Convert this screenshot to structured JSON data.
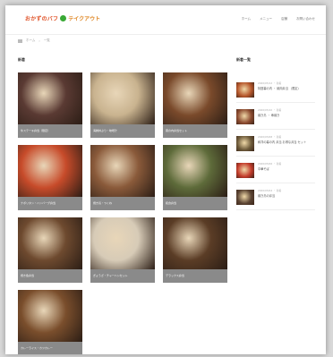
{
  "header": {
    "logo_text": "おかずのバフ",
    "logo_text2": "テイクアウト",
    "nav": [
      "ホーム",
      "メニュー",
      "店舗",
      "お問い合わせ"
    ]
  },
  "breadcrumb": {
    "items": [
      "ホーム",
      "一覧"
    ]
  },
  "main": {
    "section_title": "新着",
    "cards": [
      {
        "caption": "牛ステーキ弁当（限定）",
        "color": "#5a3a33"
      },
      {
        "caption": "海鮮丼ぶり・味噌汁",
        "color": "#c9b38f"
      },
      {
        "caption": "幕の内弁当セット",
        "color": "#7a4a2b"
      },
      {
        "caption": "ナポリタン・ハンバーグ弁当",
        "color": "#c74b2a"
      },
      {
        "caption": "焼き鳥・つくね",
        "color": "#8a5a3a"
      },
      {
        "caption": "和食弁当",
        "color": "#5e6b3a"
      },
      {
        "caption": "焼き魚弁当",
        "color": "#6e4a2f"
      },
      {
        "caption": "ぎょうざ・チャーハンセット",
        "color": "#d7cbb7"
      },
      {
        "caption": "デラックス弁当",
        "color": "#5b3d26"
      },
      {
        "caption": "カレーライス・カツカレー",
        "color": "#7a4e2c"
      }
    ]
  },
  "sidebar": {
    "title": "新着一覧",
    "items": [
      {
        "meta": "2020/05/12 ・ 新着",
        "title": "特選幕の内 ・ 焼肉弁当 （限定）",
        "color": "#b5562b"
      },
      {
        "meta": "2020/05/10 ・ 新着",
        "title": "焼き鳥 ・ 串焼き",
        "color": "#8b4a2f"
      },
      {
        "meta": "2020/05/08 ・ 新着",
        "title": "和洋の幕の内 弁当 お得な弁当 セット",
        "color": "#6d5a3a"
      },
      {
        "meta": "2020/05/06 ・ 新着",
        "title": "中華そば",
        "color": "#c23a2a"
      },
      {
        "meta": "2020/05/04 ・ 新着",
        "title": "焼き鳥の弁当",
        "color": "#5a4332"
      }
    ]
  }
}
